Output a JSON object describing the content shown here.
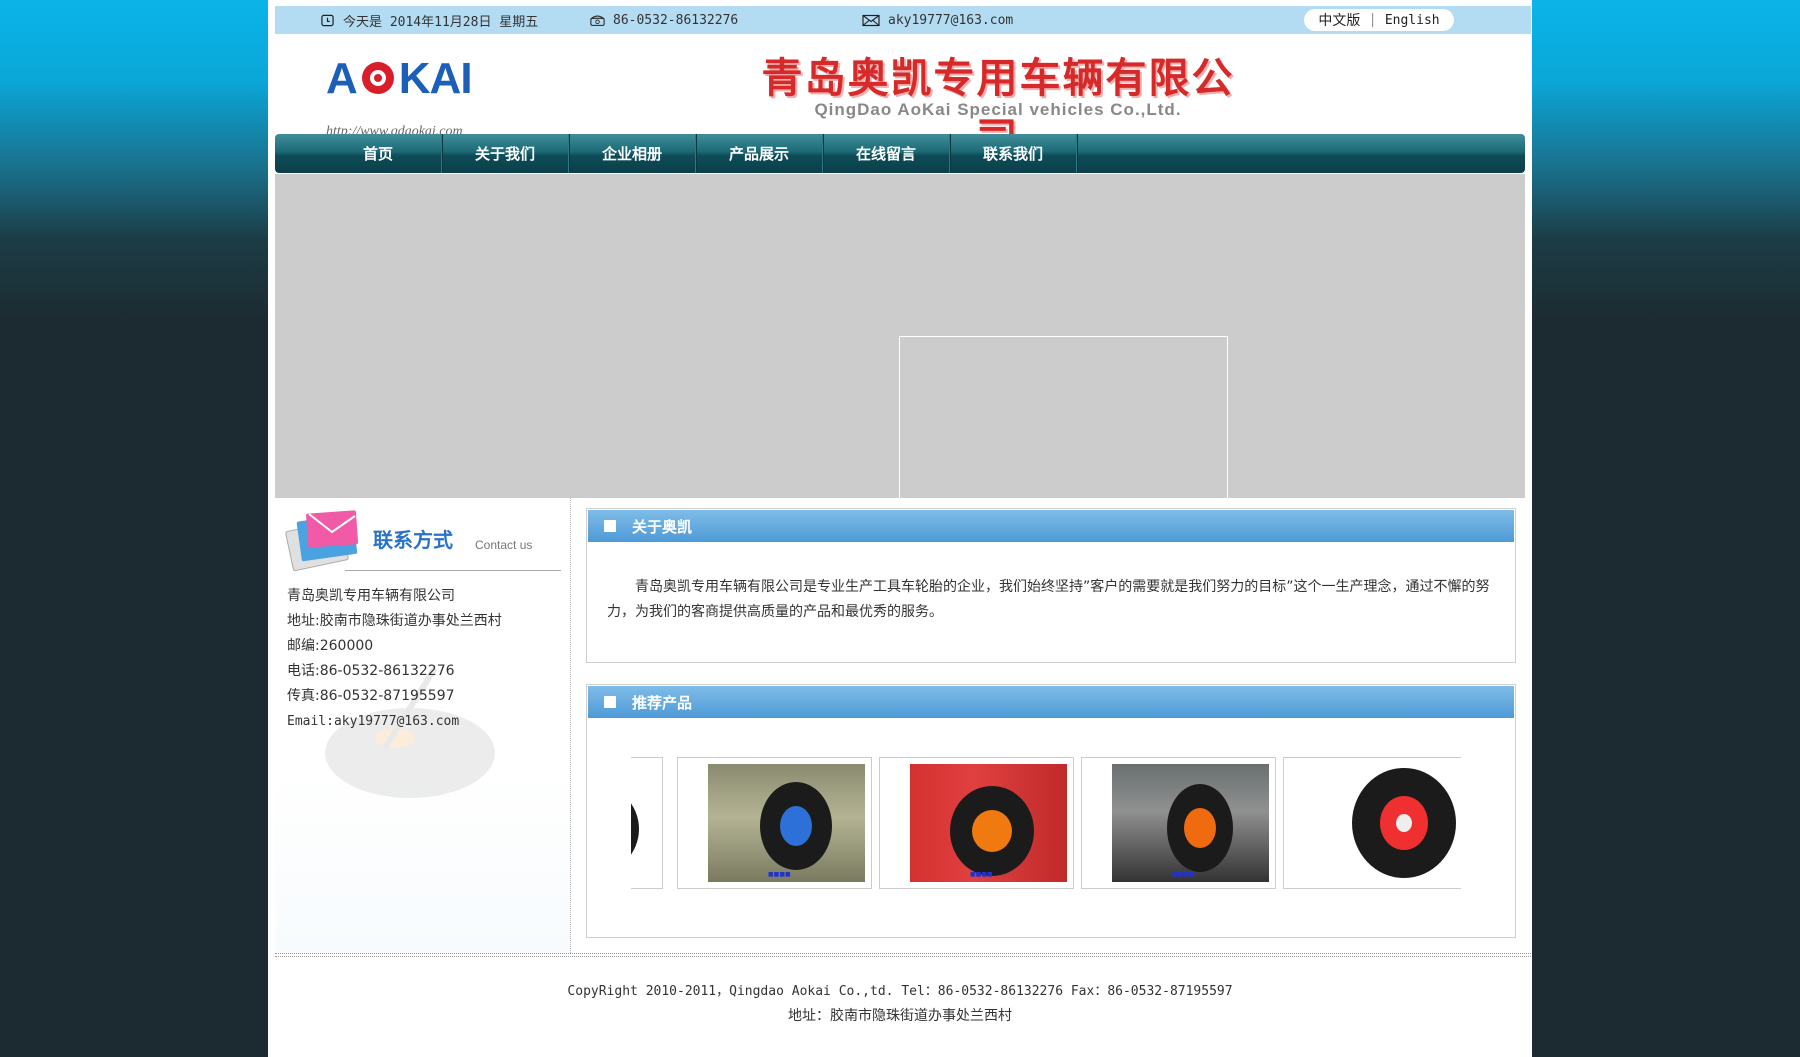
{
  "topbar": {
    "date_text": "今天是 2014年11月28日 星期五",
    "phone": "86-0532-86132276",
    "email": "aky19777@163.com",
    "lang_cn": "中文版",
    "lang_sep": "|",
    "lang_en": "English"
  },
  "header": {
    "logo_text": "AOKAI",
    "logo_url": "http://www.qdaokai.com",
    "company_cn": "青岛奥凯专用车辆有限公司",
    "company_en": "QingDao AoKai Special vehicles Co.,Ltd."
  },
  "nav": {
    "items": [
      "首页",
      "关于我们",
      "企业相册",
      "产品展示",
      "在线留言",
      "联系我们"
    ]
  },
  "contact": {
    "title": "联系方式",
    "subtitle": "Contact us",
    "company": "青岛奥凯专用车辆有限公司",
    "address": "地址:胶南市隐珠街道办事处兰西村",
    "postcode": "邮编:260000",
    "phone": "电话:86-0532-86132276",
    "fax": "传真:86-0532-87195597",
    "email": "Email:aky19777@163.com"
  },
  "about": {
    "title": "关于奥凯",
    "text": "青岛奥凯专用车辆有限公司是专业生产工具车轮胎的企业，我们始终坚持”客户的需要就是我们努力的目标”这个一生产理念，通过不懈的努力，为我们的客商提供高质量的产品和最优秀的服务。"
  },
  "products": {
    "title": "推荐产品"
  },
  "footer": {
    "copyright": "CopyRight 2010-2011，Qingdao Aokai Co.,td.  Tel：86-0532-86132276 Fax：86-0532-87195597",
    "address": "地址：胶南市隐珠街道办事处兰西村"
  },
  "colors": {
    "nav_bg": "#0d4d58",
    "topbar_bg": "#b3dcf3",
    "panel_header": "#4e9ad6",
    "company_red": "#d62a2a",
    "logo_blue": "#1c5fb8"
  }
}
